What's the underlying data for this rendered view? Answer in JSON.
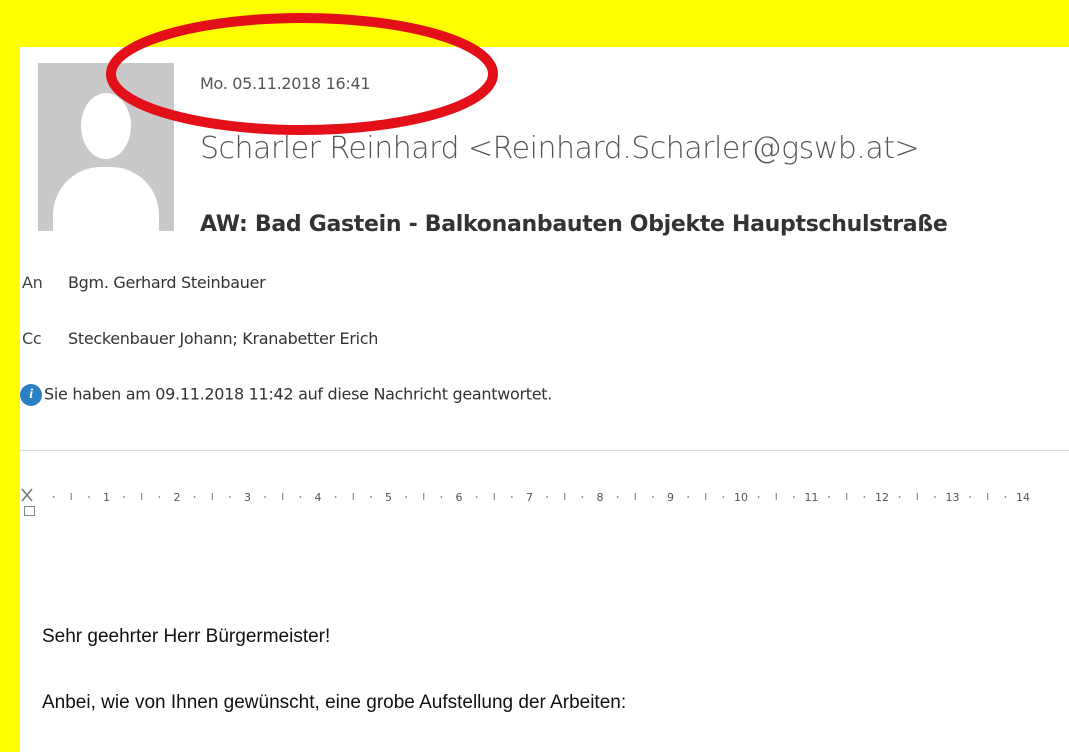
{
  "mail": {
    "date": "Mo. 05.11.2018 16:41",
    "sender": "Scharler Reinhard <Reinhard.Scharler@gswb.at>",
    "subject": "AW: Bad Gastein - Balkonanbauten Objekte Hauptschulstraße",
    "to_label": "An",
    "to": "Bgm. Gerhard Steinbauer",
    "cc_label": "Cc",
    "cc": "Steckenbauer Johann; Kranabetter Erich",
    "info": "Sie haben am 09.11.2018 11:42 auf diese Nachricht geantwortet."
  },
  "ruler": {
    "ticks": [
      "1",
      "2",
      "3",
      "4",
      "5",
      "6",
      "7",
      "8",
      "9",
      "10",
      "11",
      "12",
      "13",
      "14"
    ]
  },
  "body": {
    "greeting": "Sehr geehrter Herr Bürgermeister!",
    "line1": "Anbei, wie von Ihnen gewünscht, eine grobe Aufstellung der Arbeiten:"
  },
  "colors": {
    "background": "#ffff00",
    "highlight_ellipse": "#e3101a",
    "info_icon": "#2c7fc5"
  },
  "icons": {
    "avatar": "person-silhouette",
    "info": "info-icon"
  }
}
